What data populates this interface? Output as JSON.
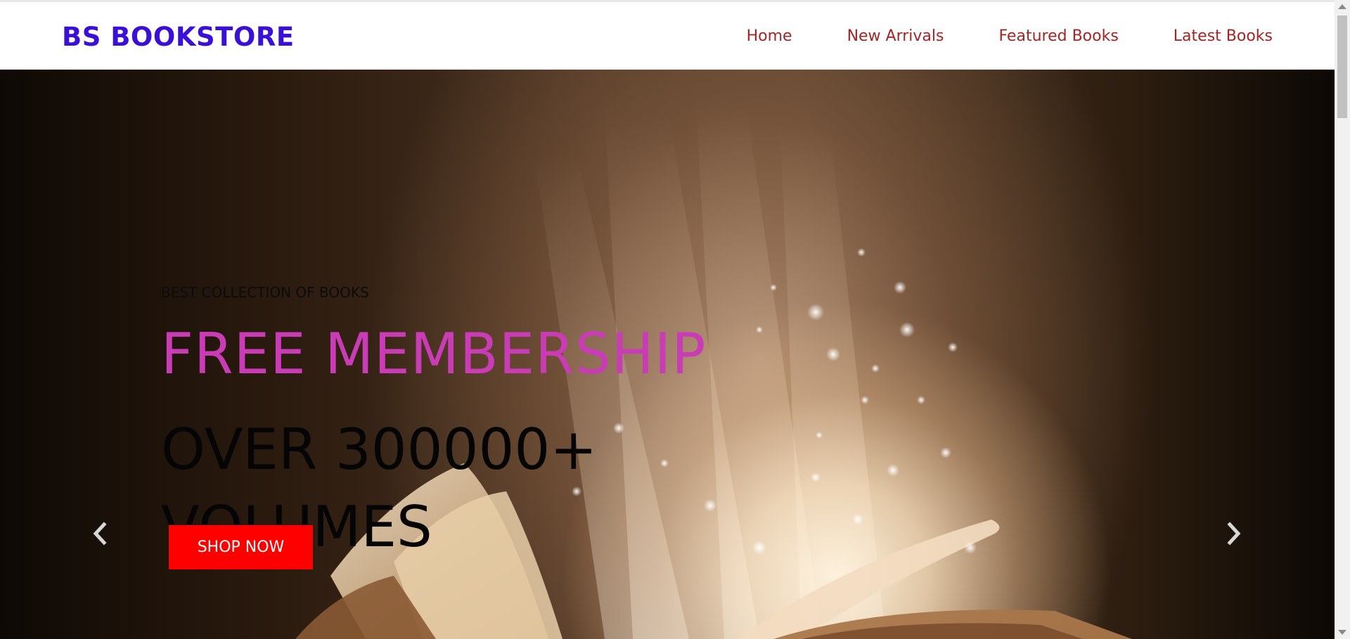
{
  "header": {
    "logo": "BS BOOKSTORE",
    "nav": [
      {
        "label": "Home"
      },
      {
        "label": "New Arrivals"
      },
      {
        "label": "Featured Books"
      },
      {
        "label": "Latest Books"
      }
    ]
  },
  "hero": {
    "eyebrow": "BEST COLLECTION OF BOOKS",
    "headline_primary": "FREE MEMBERSHIP",
    "headline_secondary_line1": "OVER 300000+",
    "headline_secondary_line2": "VOLUMES",
    "cta_label": "SHOP NOW",
    "prev_icon": "chevron-left-icon",
    "next_icon": "chevron-right-icon"
  },
  "colors": {
    "logo": "#3a10d8",
    "nav_link": "#a52424",
    "headline_primary": "#c93cb6",
    "cta_background": "#fe0000"
  }
}
